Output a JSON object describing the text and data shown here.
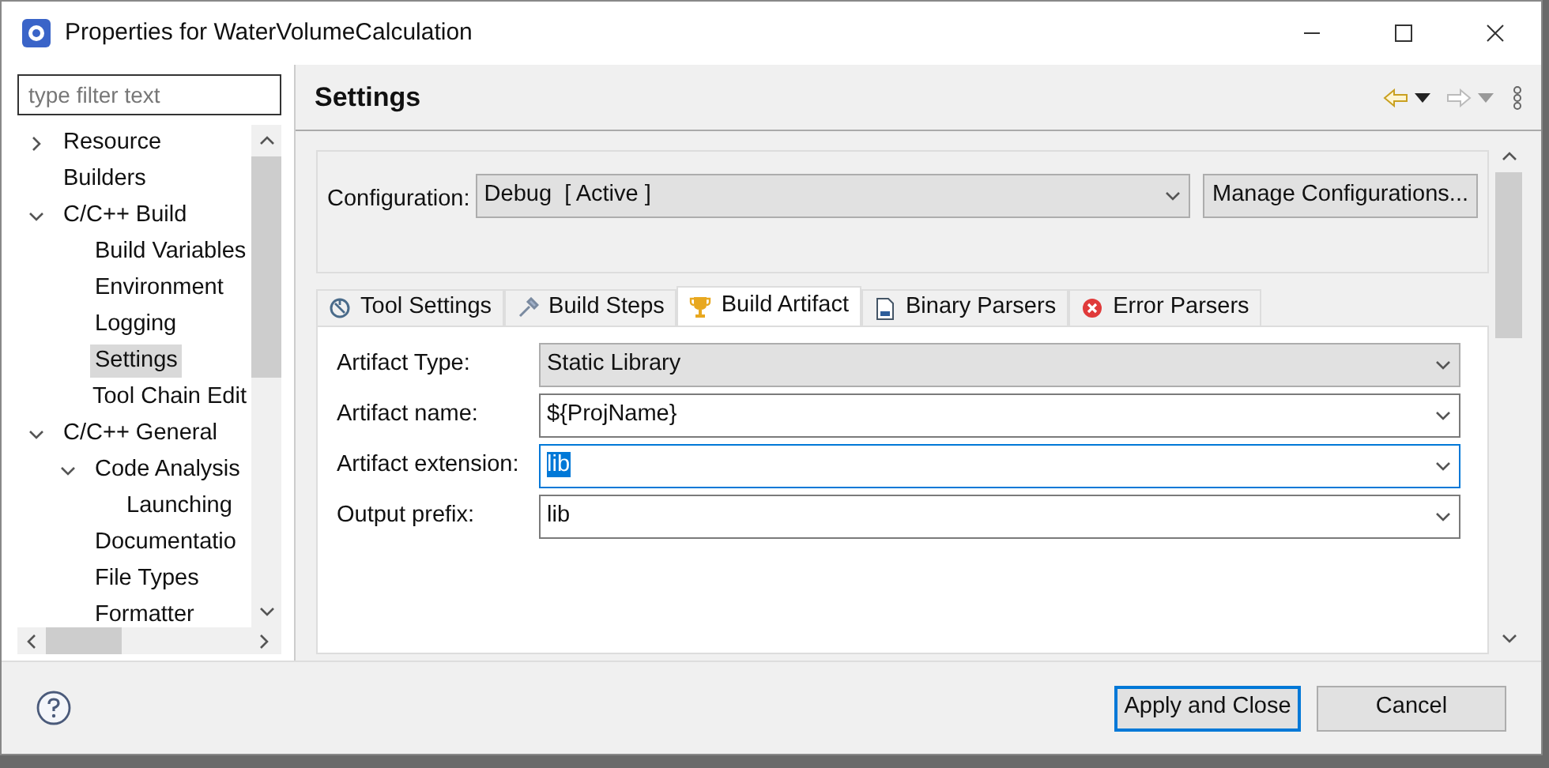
{
  "window": {
    "title": "Properties for WaterVolumeCalculation"
  },
  "filter": {
    "placeholder": "type filter text"
  },
  "tree": [
    {
      "label": "Resource",
      "expanded": false,
      "selected": false
    },
    {
      "label": "Builders",
      "selected": false
    },
    {
      "label": "C/C++ Build",
      "expanded": true,
      "selected": false,
      "children": [
        {
          "label": "Build Variables",
          "selected": false
        },
        {
          "label": "Environment",
          "selected": false
        },
        {
          "label": "Logging",
          "selected": false
        },
        {
          "label": "Settings",
          "selected": true
        },
        {
          "label": "Tool Chain Edit",
          "selected": false
        }
      ]
    },
    {
      "label": "C/C++ General",
      "expanded": true,
      "selected": false,
      "children": [
        {
          "label": "Code Analysis",
          "expanded": true,
          "selected": false,
          "children": [
            {
              "label": "Launching",
              "selected": false
            }
          ]
        },
        {
          "label": "Documentatio",
          "selected": false
        },
        {
          "label": "File Types",
          "selected": false
        },
        {
          "label": "Formatter",
          "selected": false
        }
      ]
    }
  ],
  "page": {
    "title": "Settings"
  },
  "configuration": {
    "label": "Configuration:",
    "value": "Debug  [ Active ]",
    "button": "Manage Configurations..."
  },
  "tabs": [
    {
      "label": "Tool Settings",
      "selected": false
    },
    {
      "label": "Build Steps",
      "selected": false
    },
    {
      "label": "Build Artifact",
      "selected": true
    },
    {
      "label": "Binary Parsers",
      "selected": false
    },
    {
      "label": "Error Parsers",
      "selected": false
    }
  ],
  "fields": [
    {
      "label": "Artifact Type:",
      "value": "Static Library",
      "kind": "readonly",
      "focused": false
    },
    {
      "label": "Artifact name:",
      "value": "${ProjName}",
      "kind": "editable",
      "focused": false
    },
    {
      "label": "Artifact extension:",
      "value": "lib",
      "kind": "editable",
      "focused": true
    },
    {
      "label": "Output prefix:",
      "value": "lib",
      "kind": "editable",
      "focused": false
    }
  ],
  "buttons": [
    {
      "label": "Apply and Close",
      "default": true
    },
    {
      "label": "Cancel",
      "default": false
    }
  ]
}
